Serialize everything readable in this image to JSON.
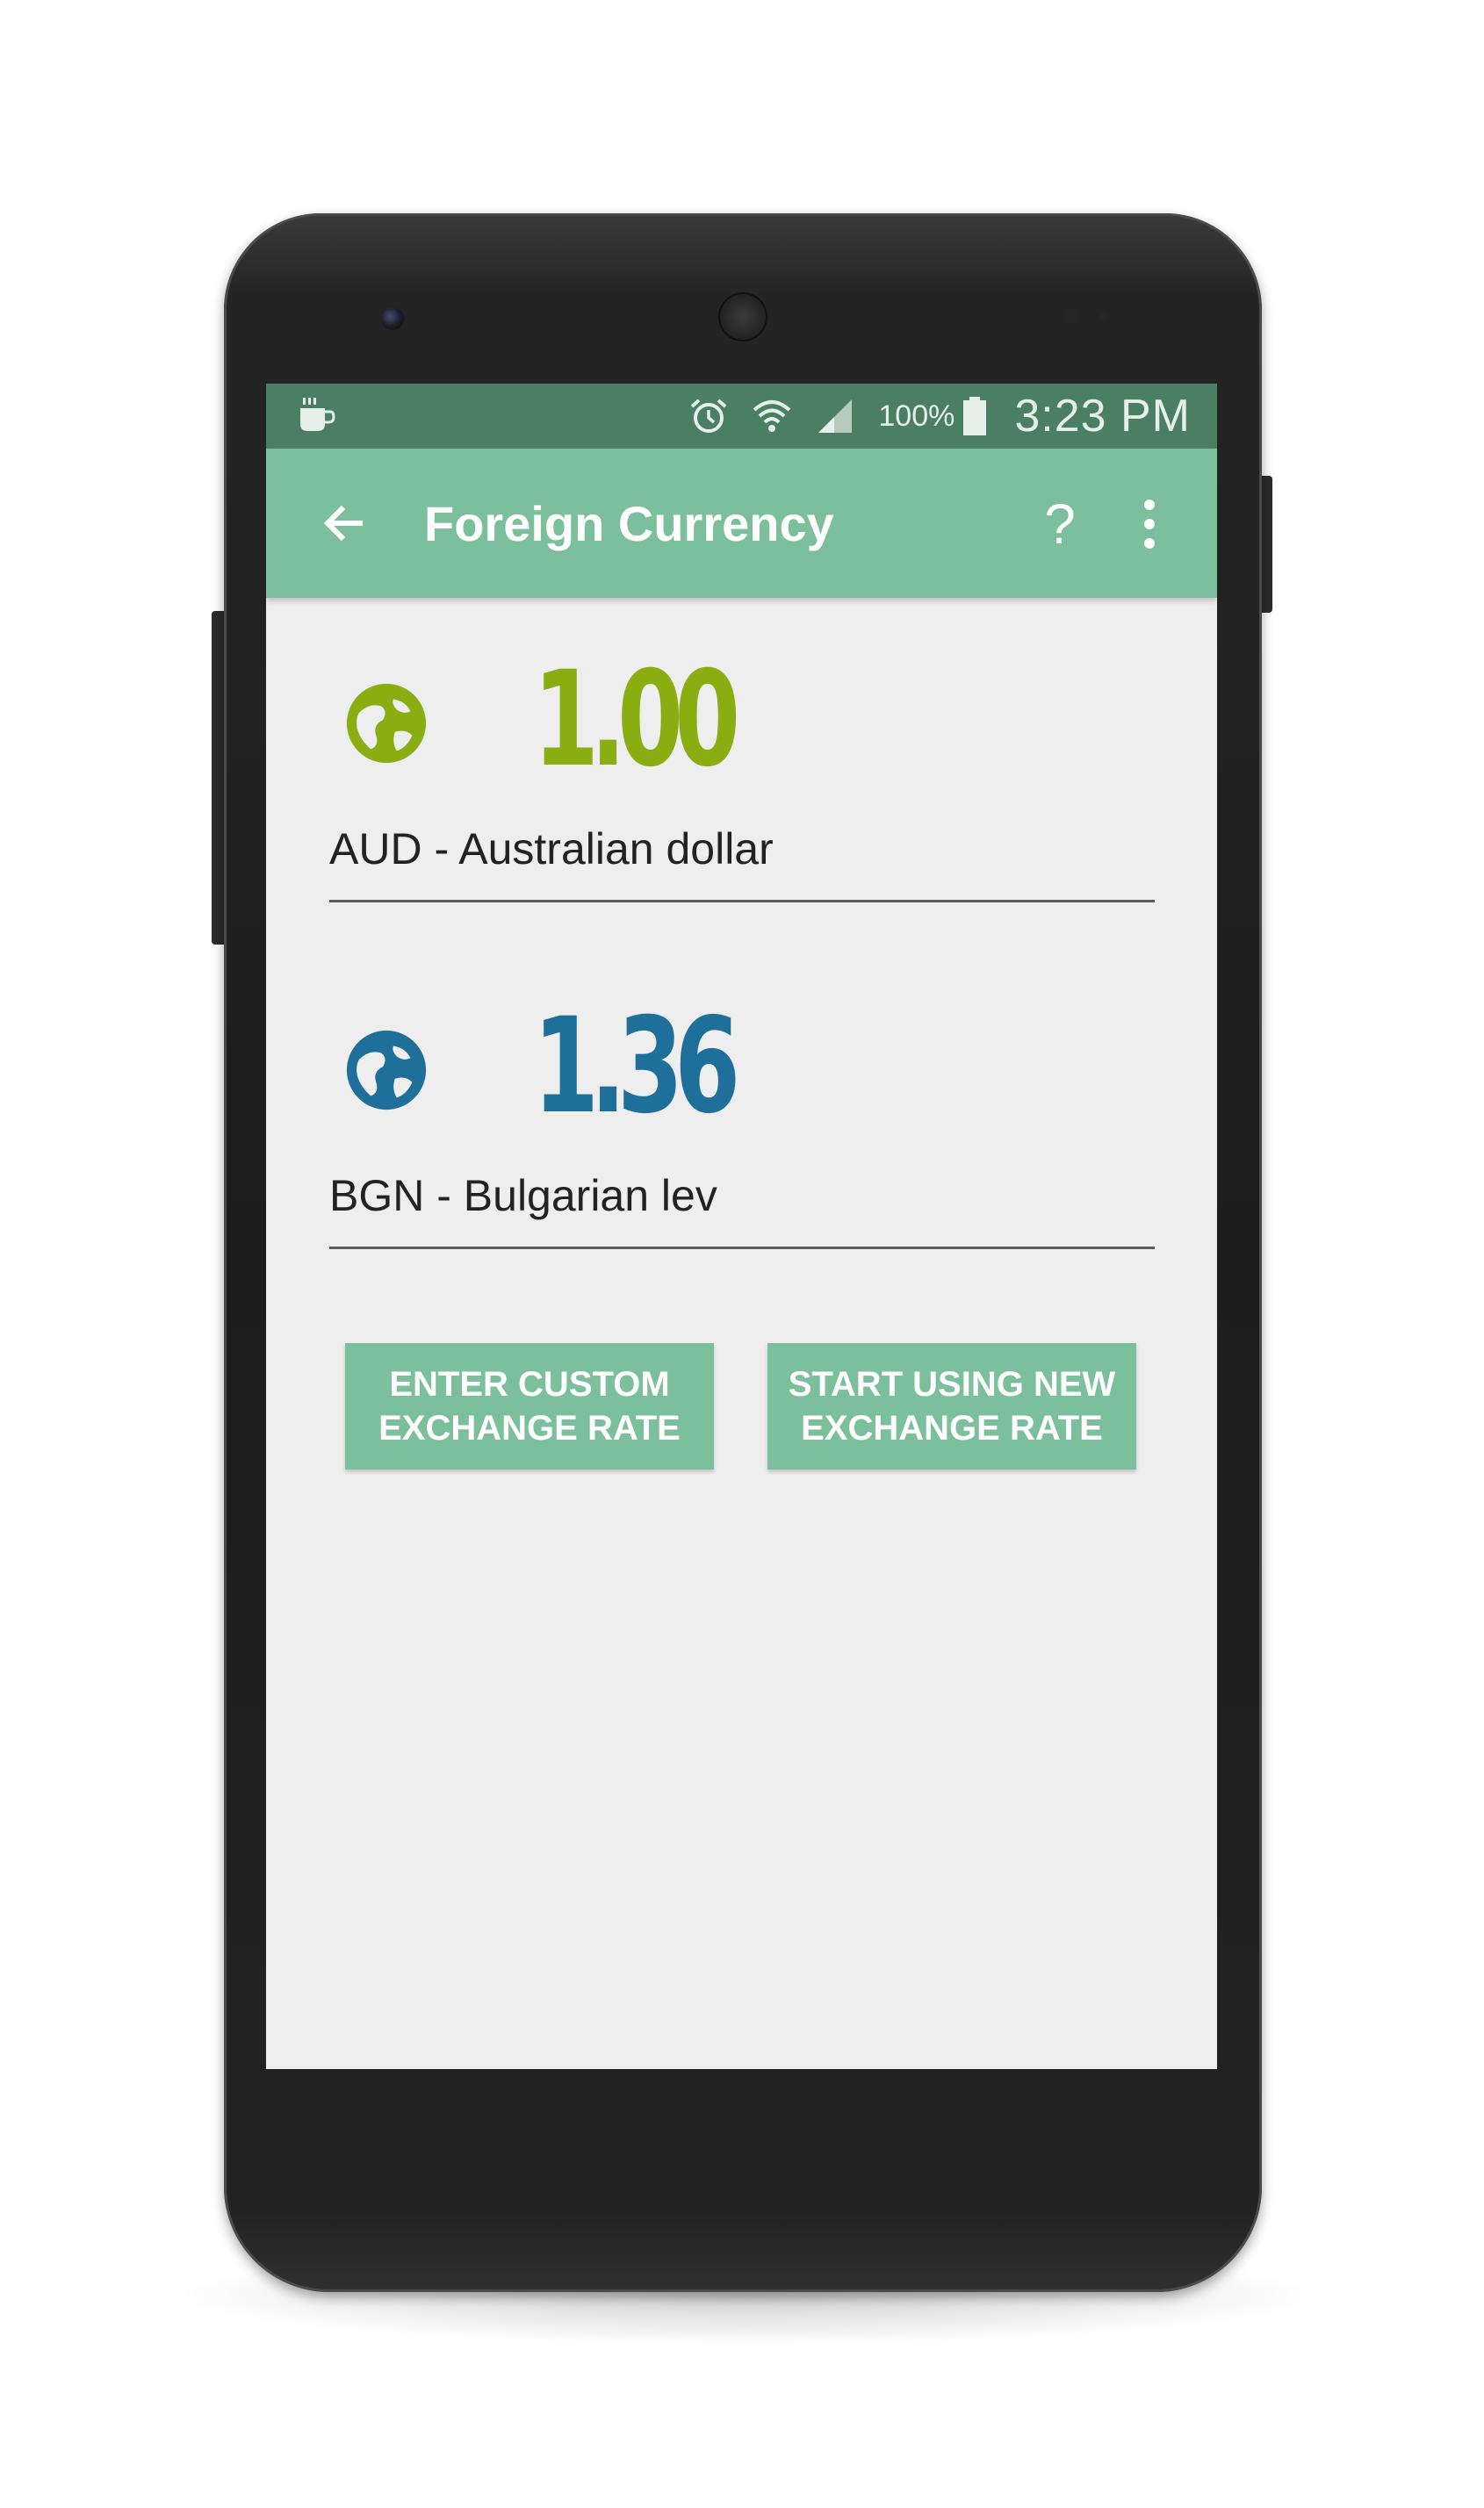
{
  "status_bar": {
    "battery_percent": "100%",
    "time": "3:23 PM",
    "icons": [
      "coffee-cup-icon",
      "alarm-clock-icon",
      "wifi-icon",
      "cell-signal-icon",
      "battery-icon"
    ]
  },
  "app_bar": {
    "title": "Foreign Currency",
    "help_label": "?",
    "back_icon": "arrow-left-icon",
    "menu_icon": "more-vert-icon"
  },
  "currencies": [
    {
      "amount": "1.00",
      "name": "AUD - Australian dollar",
      "color": "#8aad12",
      "icon": "globe-icon"
    },
    {
      "amount": "1.36",
      "name": "BGN - Bulgarian lev",
      "color": "#1e6f99",
      "icon": "globe-icon"
    }
  ],
  "buttons": {
    "custom_rate": {
      "line1": "ENTER CUSTOM",
      "line2": "EXCHANGE RATE"
    },
    "new_rate": {
      "line1": "START USING NEW",
      "line2": "EXCHANGE RATE"
    }
  },
  "colors": {
    "status_bar": "#4a7f63",
    "accent": "#7bbf9c",
    "background": "#eeeeee"
  }
}
